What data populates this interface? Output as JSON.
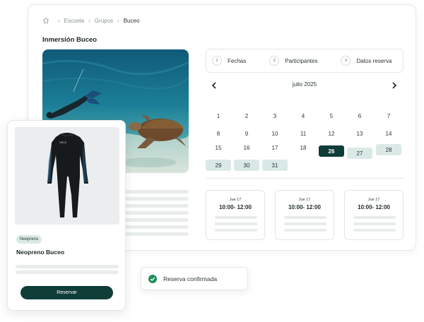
{
  "breadcrumb": {
    "items": [
      "Escuela",
      "Grupos"
    ],
    "current": "Buceo"
  },
  "page_title": "Inmersión Buceo",
  "steps": [
    {
      "num": "1",
      "label": "Fechas"
    },
    {
      "num": "2",
      "label": "Participantes"
    },
    {
      "num": "3",
      "label": "Datos reserva"
    }
  ],
  "calendar": {
    "month": "julio 2025",
    "days": [
      "1",
      "2",
      "3",
      "4",
      "5",
      "6",
      "7",
      "8",
      "9",
      "10",
      "11",
      "12",
      "13",
      "14",
      "15",
      "16",
      "17",
      "18",
      "26",
      "27",
      "28",
      "29",
      "30",
      "31"
    ],
    "selected": "26",
    "available": [
      "27",
      "28",
      "29",
      "30",
      "31"
    ]
  },
  "slots": [
    {
      "date": "Jue 17",
      "time": "10:00- 12:00"
    },
    {
      "date": "Jue 17",
      "time": "10:00- 12:00"
    },
    {
      "date": "Jue 17",
      "time": "10:00- 12:00"
    }
  ],
  "product": {
    "badge": "Neopreno",
    "title": "Neopreno Buceo",
    "button_label": "Reservar",
    "wetsuit_logo": "ORCA"
  },
  "toast": {
    "message": "Reserva confirmada",
    "icon": "check-circle-icon",
    "color": "#1f8f5a"
  },
  "colors": {
    "accent": "#0f3d38",
    "accent_light": "#dbe9e6"
  }
}
